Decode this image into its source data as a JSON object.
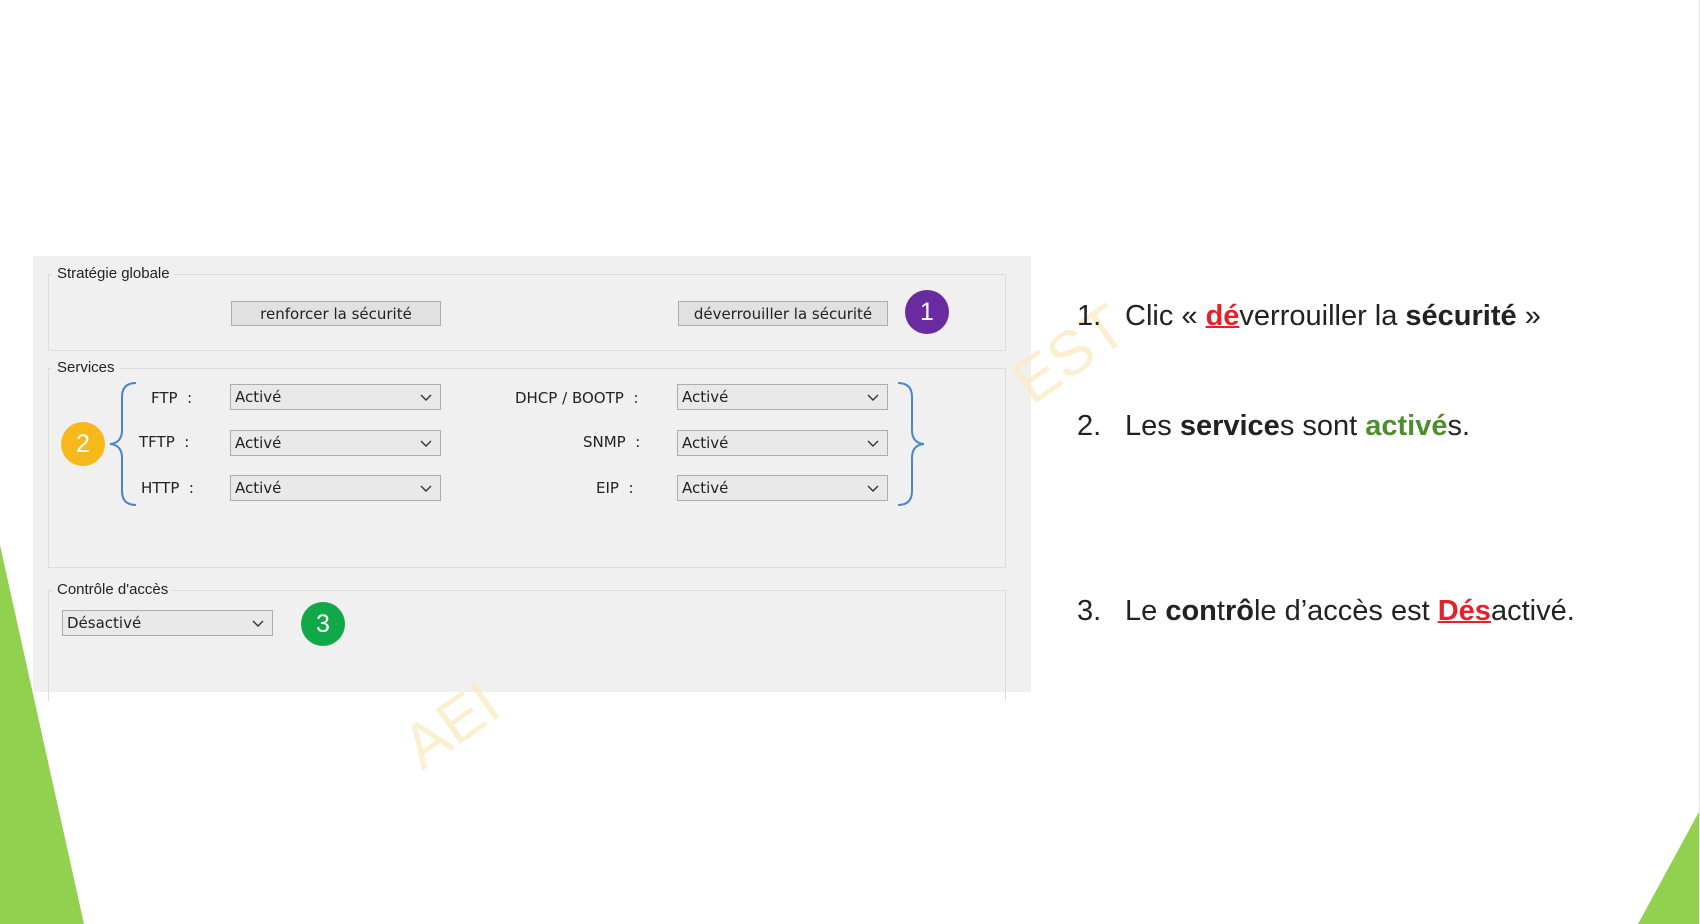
{
  "dialog": {
    "global_strategy": {
      "title": "Stratégie globale",
      "reinforce_button": "renforcer la sécurité",
      "unlock_button": "déverrouiller la sécurité"
    },
    "services": {
      "title": "Services",
      "left": [
        {
          "label": "FTP  :",
          "value": "Activé"
        },
        {
          "label": "TFTP  :",
          "value": "Activé"
        },
        {
          "label": "HTTP  :",
          "value": "Activé"
        }
      ],
      "right": [
        {
          "label": "DHCP / BOOTP  :",
          "value": "Activé"
        },
        {
          "label": "SNMP  :",
          "value": "Activé"
        },
        {
          "label": "EIP  :",
          "value": "Activé"
        }
      ]
    },
    "access_control": {
      "title": "Contrôle d'accès",
      "value": "Désactivé"
    }
  },
  "badges": {
    "b1": {
      "text": "1",
      "color": "#6a2aa0"
    },
    "b2": {
      "text": "2",
      "color": "#f7b81b"
    },
    "b3": {
      "text": "3",
      "color": "#11a84a"
    }
  },
  "watermark": {
    "left": "AEI",
    "right": "EST"
  },
  "notes": [
    {
      "number": "1.",
      "parts": [
        "Clic « ",
        "dé",
        "verrouiller la ",
        "sécurité",
        " »"
      ]
    },
    {
      "number": "2.",
      "parts": [
        "Les ",
        "service",
        "s sont ",
        "activé",
        "s."
      ]
    },
    {
      "number": "3.",
      "parts": [
        "Le ",
        "con",
        "t",
        "r",
        "ô",
        "le d’accès est ",
        "Dés",
        "activé."
      ]
    }
  ],
  "colors": {
    "slide_accent_green": "#92d050",
    "highlight_red": "#e8202a",
    "highlight_green": "#4e8f2d"
  }
}
